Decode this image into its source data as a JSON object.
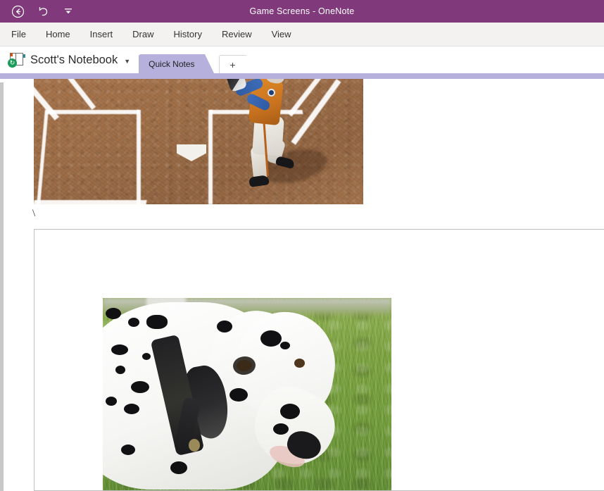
{
  "titlebar": {
    "document_title": "Game Screens  -  OneNote",
    "quick_access": [
      {
        "name": "back-icon",
        "glyph": "back"
      },
      {
        "name": "undo-icon",
        "glyph": "undo"
      },
      {
        "name": "customize-quick-access-toolbar-icon",
        "glyph": "caret"
      }
    ],
    "accent_color": "#80397B"
  },
  "ribbon": {
    "tabs": [
      {
        "label": "File"
      },
      {
        "label": "Home"
      },
      {
        "label": "Insert"
      },
      {
        "label": "Draw"
      },
      {
        "label": "History"
      },
      {
        "label": "Review"
      },
      {
        "label": "View"
      }
    ],
    "background_color": "#F3F2F1"
  },
  "navigation": {
    "notebook_name": "Scott's Notebook",
    "notebook_caret": "▼",
    "sync_glyph": "↻",
    "sections": [
      {
        "label": "Quick Notes",
        "active": true,
        "color": "#B5B0DC"
      }
    ],
    "add_section_label": "+"
  },
  "page": {
    "section_strip_color": "#B5B0DC",
    "gutter_color": "#C9C7C5",
    "background_color": "#FFFFFF",
    "text_note": "\\",
    "images": [
      {
        "name": "baseball-game-screenshot",
        "alt": "Baseball video game screenshot showing home plate, batter's boxes and a batter in an orange jersey",
        "dominant_colors": [
          "#9c6c45",
          "#ffffff",
          "#d7821f",
          "#2f5ba3"
        ]
      },
      {
        "name": "dalmatian-photo",
        "alt": "Dalmatian dog with a black collar standing on green grass",
        "dominant_colors": [
          "#ffffff",
          "#111113",
          "#79a03f"
        ]
      }
    ],
    "note_container_border_color": "#BFBFBF"
  }
}
